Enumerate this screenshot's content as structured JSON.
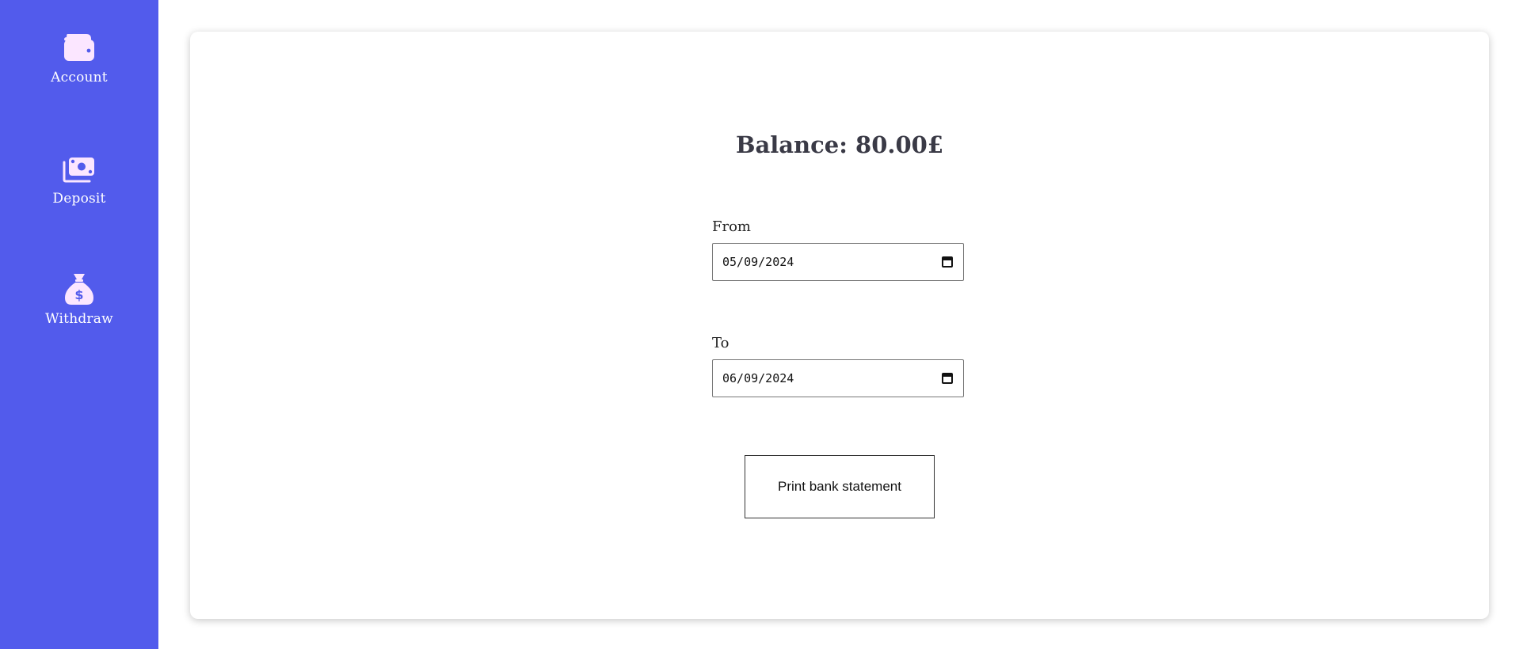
{
  "colors": {
    "sidebar": "#525bec",
    "icon_fill": "#fbe6ff",
    "icon_accent": "#525bec",
    "heading_text": "#3a3a46"
  },
  "sidebar": {
    "items": [
      {
        "label": "Account",
        "icon": "wallet-icon"
      },
      {
        "label": "Deposit",
        "icon": "money-bills-icon"
      },
      {
        "label": "Withdraw",
        "icon": "money-bag-icon"
      }
    ]
  },
  "main": {
    "balance_text": "Balance: 80.00£",
    "from": {
      "label": "From",
      "value": "05/09/2024",
      "icon": "calendar-icon"
    },
    "to": {
      "label": "To",
      "value": "06/09/2024",
      "icon": "calendar-icon"
    },
    "print_button_label": "Print bank statement"
  }
}
